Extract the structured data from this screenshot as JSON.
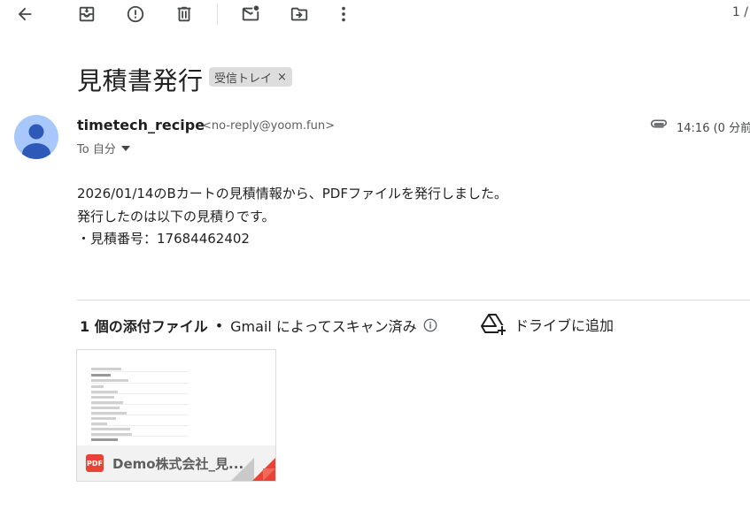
{
  "toolbar": {
    "back_icon": "arrow-left-icon",
    "archive_icon": "archive-icon",
    "report_icon": "report-spam-icon",
    "delete_icon": "trash-icon",
    "mark_unread_icon": "mark-unread-icon",
    "move_icon": "move-to-icon",
    "more_icon": "more-vert-icon",
    "pager": "1 /"
  },
  "email": {
    "subject": "見積書発行",
    "label": "受信トレイ",
    "label_close": "×",
    "sender_name": "timetech_recipe",
    "sender_email": "<no-reply@yoom.fun>",
    "to": "To 自分",
    "time": "14:16 (0 分前",
    "body": [
      "2026/01/14のBカートの見積情報から、PDFファイルを発行しました。",
      "発行したのは以下の見積りです。",
      "・見積番号：17684462402"
    ]
  },
  "attachments": {
    "count_label": "1 個の添付ファイル",
    "separator": "•",
    "scan_label": "Gmail によってスキャン済み",
    "drive_label": "ドライブに追加",
    "file": {
      "name": "Demo株式会社_見...",
      "type_label": "PDF"
    }
  },
  "colors": {
    "avatar": "#a8c7fa",
    "pdf_red": "#ea4335",
    "chip_bg": "#dddddd"
  }
}
